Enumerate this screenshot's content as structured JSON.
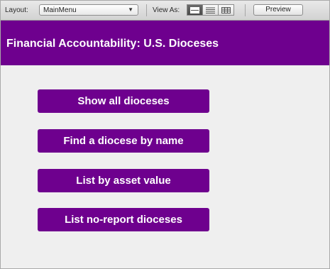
{
  "toolbar": {
    "layout_label": "Layout:",
    "layout_value": "MainMenu",
    "view_as_label": "View As:",
    "view_modes": [
      "form-view-icon",
      "list-view-icon",
      "table-view-icon"
    ],
    "preview_label": "Preview"
  },
  "header": {
    "title": "Financial Accountability: U.S. Dioceses"
  },
  "menu": {
    "items": [
      {
        "label": "Show all dioceses"
      },
      {
        "label": "Find a diocese by name"
      },
      {
        "label": "List by asset value"
      },
      {
        "label": "List no-report dioceses"
      }
    ]
  },
  "colors": {
    "brand_purple": "#6e008e",
    "background": "#efefef",
    "button_text": "#ffffff"
  }
}
